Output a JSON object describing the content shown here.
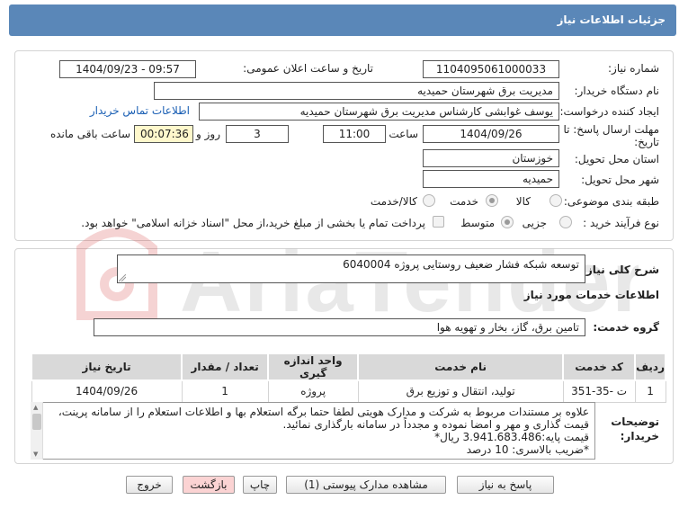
{
  "header": {
    "title": "جزئیات اطلاعات نیاز"
  },
  "form": {
    "need_number_label": "شماره نیاز:",
    "need_number": "1104095061000033",
    "announce_label": "تاریخ و ساعت اعلان عمومی:",
    "announce_value": "1404/09/23 - 09:57",
    "buyer_org_label": "نام دستگاه خریدار:",
    "buyer_org": "مدیریت برق شهرستان حمیدیه",
    "creator_label": "ایجاد کننده درخواست:",
    "creator": "یوسف غوابشی کارشناس مدیریت برق شهرستان حمیدیه",
    "buyer_contact_link": "اطلاعات تماس خریدار",
    "deadline_label_1": "مهلت ارسال پاسخ: تا",
    "deadline_label_2": "تاریخ:",
    "deadline_date": "1404/09/26",
    "time_label": "ساعت",
    "deadline_time": "11:00",
    "days_value": "3",
    "days_label": "روز و",
    "remaining_time": "00:07:36",
    "remaining_label": "ساعت باقی مانده",
    "province_label": "استان محل تحویل:",
    "province": "خوزستان",
    "city_label": "شهر محل تحویل:",
    "city": "حمیدیه",
    "category_label": "طبقه بندی موضوعی:",
    "category_options": [
      "کالا",
      "خدمت",
      "کالا/خدمت"
    ],
    "category_selected": "خدمت",
    "process_label": "نوع فرآیند خرید :",
    "process_options": [
      "جزیی",
      "متوسط"
    ],
    "process_selected": "متوسط",
    "payment_note": "پرداخت تمام یا بخشی از مبلغ خرید،از محل \"اسناد خزانه اسلامی\" خواهد بود."
  },
  "details": {
    "summary_label": "شرح کلی نیاز:",
    "summary": "توسعه شبکه فشار ضعیف روستایی پروژه 6040004",
    "services_heading": "اطلاعات خدمات مورد نیاز",
    "service_group_label": "گروه خدمت:",
    "service_group": "تامین برق، گاز، بخار و تهویه هوا",
    "table": {
      "headers": [
        "ردیف",
        "کد خدمت",
        "نام خدمت",
        "واحد اندازه گیری",
        "تعداد / مقدار",
        "تاریخ نیاز"
      ],
      "rows": [
        [
          "1",
          "ت -35-351",
          "تولید، انتقال و توزیع برق",
          "پروژه",
          "1",
          "1404/09/26"
        ]
      ]
    },
    "buyer_notes_label_1": "توضیحات",
    "buyer_notes_label_2": "خریدار:",
    "buyer_notes_lines": [
      "علاوه بر مستندات مربوط به شرکت و مدارک هویتی لطفا حتما برگه استعلام بها و اطلاعات استعلام را از سامانه پرینت،",
      "قیمت گذاری و مهر و امضا نموده و مجدداً در سامانه بارگذاری نمائید.",
      " قیمت پایه:3.941.683.486 ریال*",
      "*ضریب بالاسری:  10 درصد"
    ]
  },
  "watermark": {
    "text": "AriaTender.net"
  },
  "buttons": {
    "reply": "پاسخ به نیاز",
    "attachments": "مشاهده مدارک پیوستی (1)",
    "print": "چاپ",
    "back": "بازگشت",
    "exit": "خروج"
  }
}
